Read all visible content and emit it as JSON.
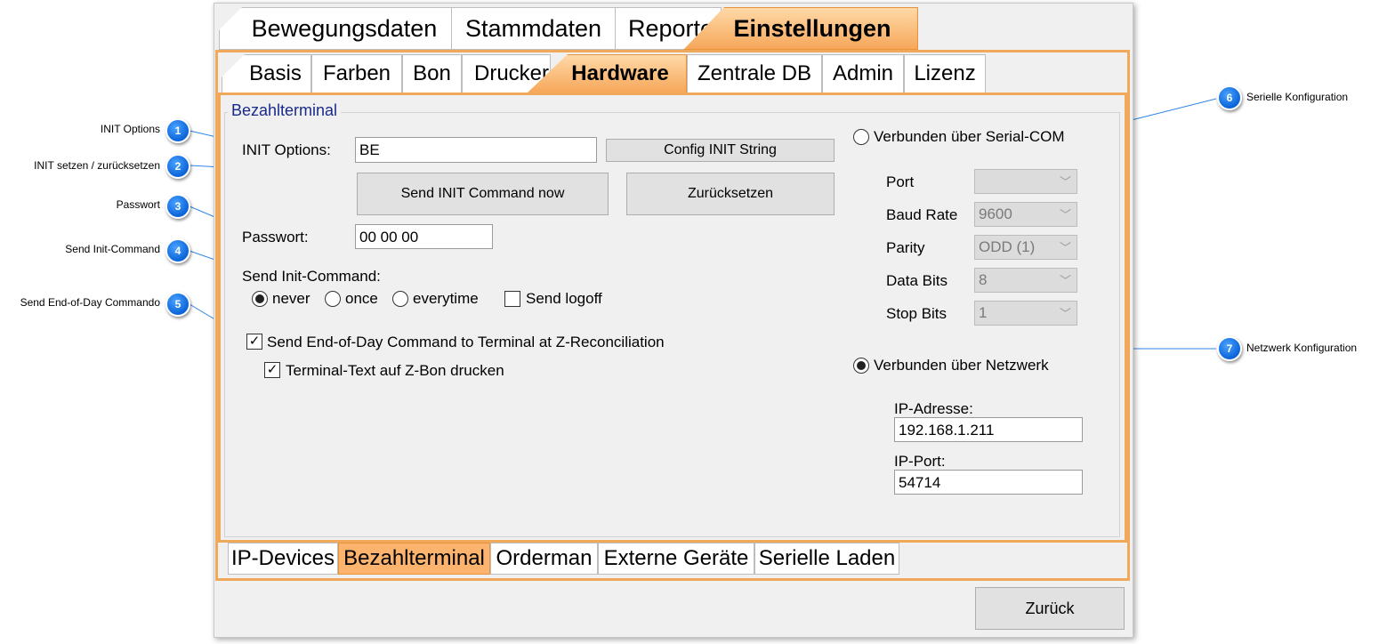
{
  "annotations": [
    {
      "num": "1",
      "text": "INIT Options"
    },
    {
      "num": "2",
      "text": "INIT setzen / zurücksetzen"
    },
    {
      "num": "3",
      "text": "Passwort"
    },
    {
      "num": "4",
      "text": "Send Init-Command"
    },
    {
      "num": "5",
      "text": "Send End-of-Day Commando"
    },
    {
      "num": "6",
      "text": "Serielle Konfiguration"
    },
    {
      "num": "7",
      "text": "Netzwerk Konfiguration"
    }
  ],
  "main_tabs": [
    "Bewegungsdaten",
    "Stammdaten",
    "Reporte",
    "Einstellungen"
  ],
  "sub_tabs": [
    "Basis",
    "Farben",
    "Bon",
    "Drucker",
    "Hardware",
    "Zentrale DB",
    "Admin",
    "Lizenz"
  ],
  "bottom_tabs": [
    "IP-Devices",
    "Bezahlterminal",
    "Orderman",
    "Externe Geräte",
    "Serielle Laden"
  ],
  "group_title": "Bezahlterminal",
  "init": {
    "label": "INIT Options:",
    "value": "BE",
    "config_button": "Config INIT String",
    "send_button": "Send INIT Command now",
    "reset_button": "Zurücksetzen"
  },
  "password": {
    "label": "Passwort:",
    "value": "00 00 00"
  },
  "send_init": {
    "label": "Send Init-Command:",
    "options": [
      "never",
      "once",
      "everytime"
    ],
    "selected": "never",
    "logoff_label": "Send logoff",
    "logoff_checked": false
  },
  "eod": {
    "label": "Send End-of-Day Command to Terminal at Z-Reconciliation",
    "checked": true,
    "print_label": "Terminal-Text auf Z-Bon drucken",
    "print_checked": true
  },
  "serial": {
    "radio_label": "Verbunden über Serial-COM",
    "selected": false,
    "fields": [
      {
        "label": "Port",
        "value": ""
      },
      {
        "label": "Baud Rate",
        "value": "9600"
      },
      {
        "label": "Parity",
        "value": "ODD (1)"
      },
      {
        "label": "Data Bits",
        "value": "8"
      },
      {
        "label": "Stop Bits",
        "value": "1"
      }
    ]
  },
  "network": {
    "radio_label": "Verbunden über Netzwerk",
    "selected": true,
    "ip_label": "IP-Adresse:",
    "ip_value": "192.168.1.211",
    "port_label": "IP-Port:",
    "port_value": "54714"
  },
  "footer": {
    "back_button": "Zurück"
  },
  "colors": {
    "accent": "#f6a75a",
    "marker": "#0a64d8",
    "group_title": "#1a2a8a"
  }
}
